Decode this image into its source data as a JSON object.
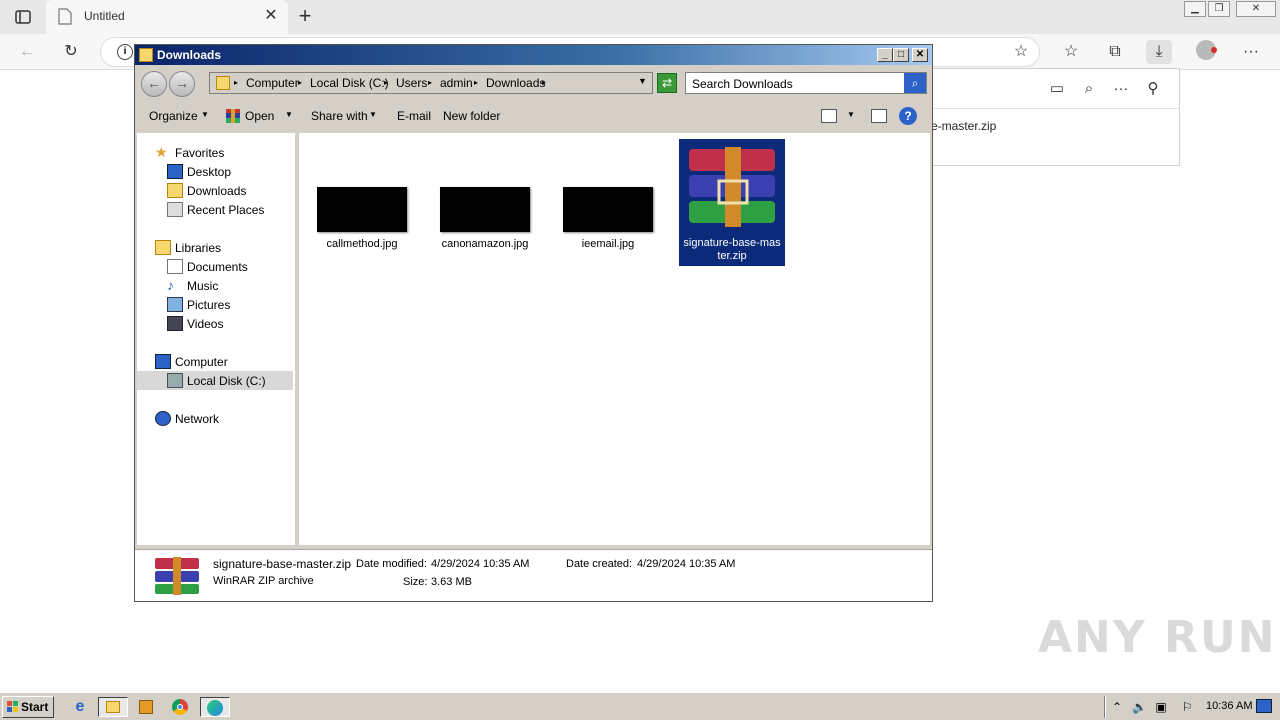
{
  "browser": {
    "tab_title": "Untitled",
    "downloads_panel": {
      "item_name": "e-master.zip"
    }
  },
  "explorer": {
    "title": "Downloads",
    "breadcrumb": [
      "Computer",
      "Local Disk (C:)",
      "Users",
      "admin",
      "Downloads"
    ],
    "search_placeholder": "Search Downloads",
    "commands": {
      "organize": "Organize",
      "open": "Open",
      "share_with": "Share with",
      "email": "E-mail",
      "new_folder": "New folder"
    },
    "nav": {
      "favorites": "Favorites",
      "favorites_items": [
        "Desktop",
        "Downloads",
        "Recent Places"
      ],
      "libraries": "Libraries",
      "libraries_items": [
        "Documents",
        "Music",
        "Pictures",
        "Videos"
      ],
      "computer": "Computer",
      "computer_items": [
        "Local Disk (C:)"
      ],
      "network": "Network"
    },
    "files": [
      {
        "name": "callmethod.jpg"
      },
      {
        "name": "canonamazon.jpg"
      },
      {
        "name": "ieemail.jpg"
      },
      {
        "name_line1": "signature-base-mas",
        "name_line2": "ter.zip",
        "selected": true
      }
    ],
    "details": {
      "name": "signature-base-master.zip",
      "type": "WinRAR ZIP archive",
      "date_modified_label": "Date modified:",
      "date_modified": "4/29/2024 10:35 AM",
      "date_created_label": "Date created:",
      "date_created": "4/29/2024 10:35 AM",
      "size_label": "Size:",
      "size": "3.63 MB"
    }
  },
  "taskbar": {
    "start_label": "Start",
    "clock": "10:36 AM"
  },
  "watermark": "ANY RUN"
}
